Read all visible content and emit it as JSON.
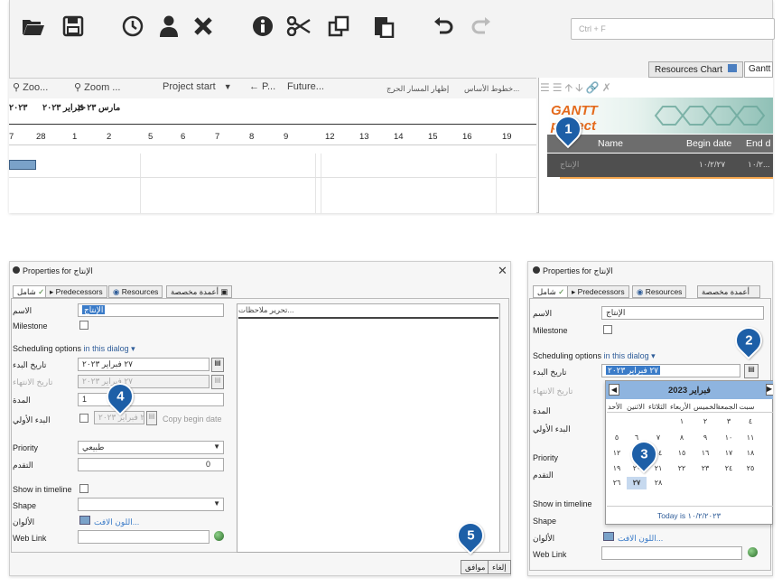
{
  "toolbar": {
    "icons": [
      "folder-open-icon",
      "save-icon",
      "clock-icon",
      "user-icon",
      "delete-icon",
      "info-icon",
      "scissors-icon",
      "copy-icon",
      "paste-icon",
      "undo-icon",
      "redo-icon"
    ],
    "search_placeholder": "Ctrl + F"
  },
  "main_window": {
    "tabs": [
      "Resources Chart",
      "Gantt"
    ],
    "gantt_toolbar": [
      "Zoo...",
      "Zoom ...",
      "Project start",
      "← P...",
      "Future...",
      "إظهار المسار الحرج",
      "خطوط الأساس..."
    ],
    "months": [
      "فبراير ٢٠٢٣",
      "مارس ٢٠٢٣"
    ],
    "year_fragment": "٢٠٢٣",
    "days": [
      "7",
      "28",
      "1",
      "2",
      "5",
      "6",
      "7",
      "8",
      "9",
      "12",
      "13",
      "14",
      "15",
      "16",
      "19"
    ],
    "columns": [
      "Name",
      "Begin date",
      "End d"
    ],
    "task": {
      "name": "الإنتاج",
      "begin": "١٠/٢/٢٧",
      "end": "١٠/٢..."
    },
    "logo_text": "GANTT project"
  },
  "dialog_left": {
    "title": "Properties for الإنتاج",
    "tabs": [
      "شامل",
      "Predecessors",
      "Resources",
      "أعمدة مخصصة"
    ],
    "name_label": "الاسم",
    "name_value": "الإنتاج",
    "milestone_label": "Milestone",
    "scheduling_label": "Scheduling options",
    "scheduling_link": "in this dialog",
    "start_label": "تاريخ البدء",
    "start_value": "٢٧ فبراير ٢٠٢٣",
    "end_label": "تاريخ الانتهاء",
    "end_value": "٢٧ فبراير ٢٠٢٣",
    "duration_label": "المدة",
    "duration_value": "1",
    "early_label": "البدء الأولي",
    "early_value": "٢٧ فبراير ٢٠٢٣",
    "copy_label": "Copy begin date",
    "priority_label": "Priority",
    "priority_value": "طبيعي",
    "progress_label": "التقدم",
    "progress_value": "0",
    "timeline_label": "Show in timeline",
    "shape_label": "Shape",
    "color_label": "الألوان",
    "color_link": "اللون الافت...",
    "weblink_label": "Web Link",
    "notes_label": "تحرير ملاحظات...",
    "ok": "موافق",
    "cancel": "إلغاء"
  },
  "dialog_right": {
    "title": "Properties for الإنتاج",
    "tabs": [
      "شامل",
      "Predecessors",
      "Resources",
      "أعمدة مخصصة"
    ],
    "name_label": "الاسم",
    "name_value": "الإنتاج",
    "milestone_label": "Milestone",
    "scheduling_label": "Scheduling options",
    "scheduling_link": "in this dialog",
    "start_label": "تاريخ البدء",
    "start_value": "٢٧ فبراير ٢٠٢٣",
    "end_label": "تاريخ الانتهاء",
    "duration_label": "المدة",
    "early_label": "البدء الأولي",
    "priority_label": "Priority",
    "progress_label": "التقدم",
    "timeline_label": "Show in timeline",
    "shape_label": "Shape",
    "color_label": "الألوان",
    "color_link": "اللون الافت...",
    "weblink_label": "Web Link",
    "calendar": {
      "header": "فبراير 2023",
      "weekdays": [
        "سبت",
        "الجمعة",
        "الخميس",
        "الأربعاء",
        "الثلاثاء",
        "الاثنين",
        "الأحد"
      ],
      "rows": [
        [
          "٤",
          "٣",
          "٢",
          "١",
          "",
          "",
          ""
        ],
        [
          "١١",
          "١٠",
          "٩",
          "٨",
          "٧",
          "٦",
          "٥"
        ],
        [
          "١٨",
          "١٧",
          "١٦",
          "١٥",
          "١٤",
          "١٣",
          "١٢"
        ],
        [
          "٢٥",
          "٢٤",
          "٢٣",
          "٢٢",
          "٢١",
          "٢٠",
          "١٩"
        ],
        [
          "",
          "",
          "",
          "",
          "٢٨",
          "٢٧",
          "٢٦"
        ]
      ],
      "selected": "٢٧",
      "today": "Today is ١٠/٢/٢٠٢٣"
    }
  },
  "callouts": [
    "1",
    "2",
    "3",
    "4",
    "5"
  ],
  "colors": {
    "callout": "#1d5fa7",
    "accent": "#3a7bc8",
    "row_dark": "#5a5a5a"
  }
}
